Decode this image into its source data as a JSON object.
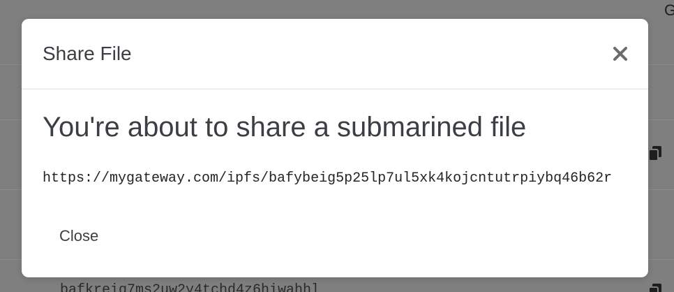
{
  "background": {
    "corner_text": "G",
    "bottom_text": "bafkreig7ms2uw2y4tchd4z6hiwahhl",
    "copy_icon": "copy-icon"
  },
  "modal": {
    "title": "Share File",
    "close_icon": "close-icon",
    "heading": "You're about to share a submarined file",
    "url": "https://mygateway.com/ipfs/bafybeig5p25lp7ul5xk4kojcntutrpiybq46b62r",
    "close_button_label": "Close"
  },
  "colors": {
    "backdrop": "#7f7f7f",
    "text": "#3b3f44",
    "divider": "#dee2e6"
  }
}
